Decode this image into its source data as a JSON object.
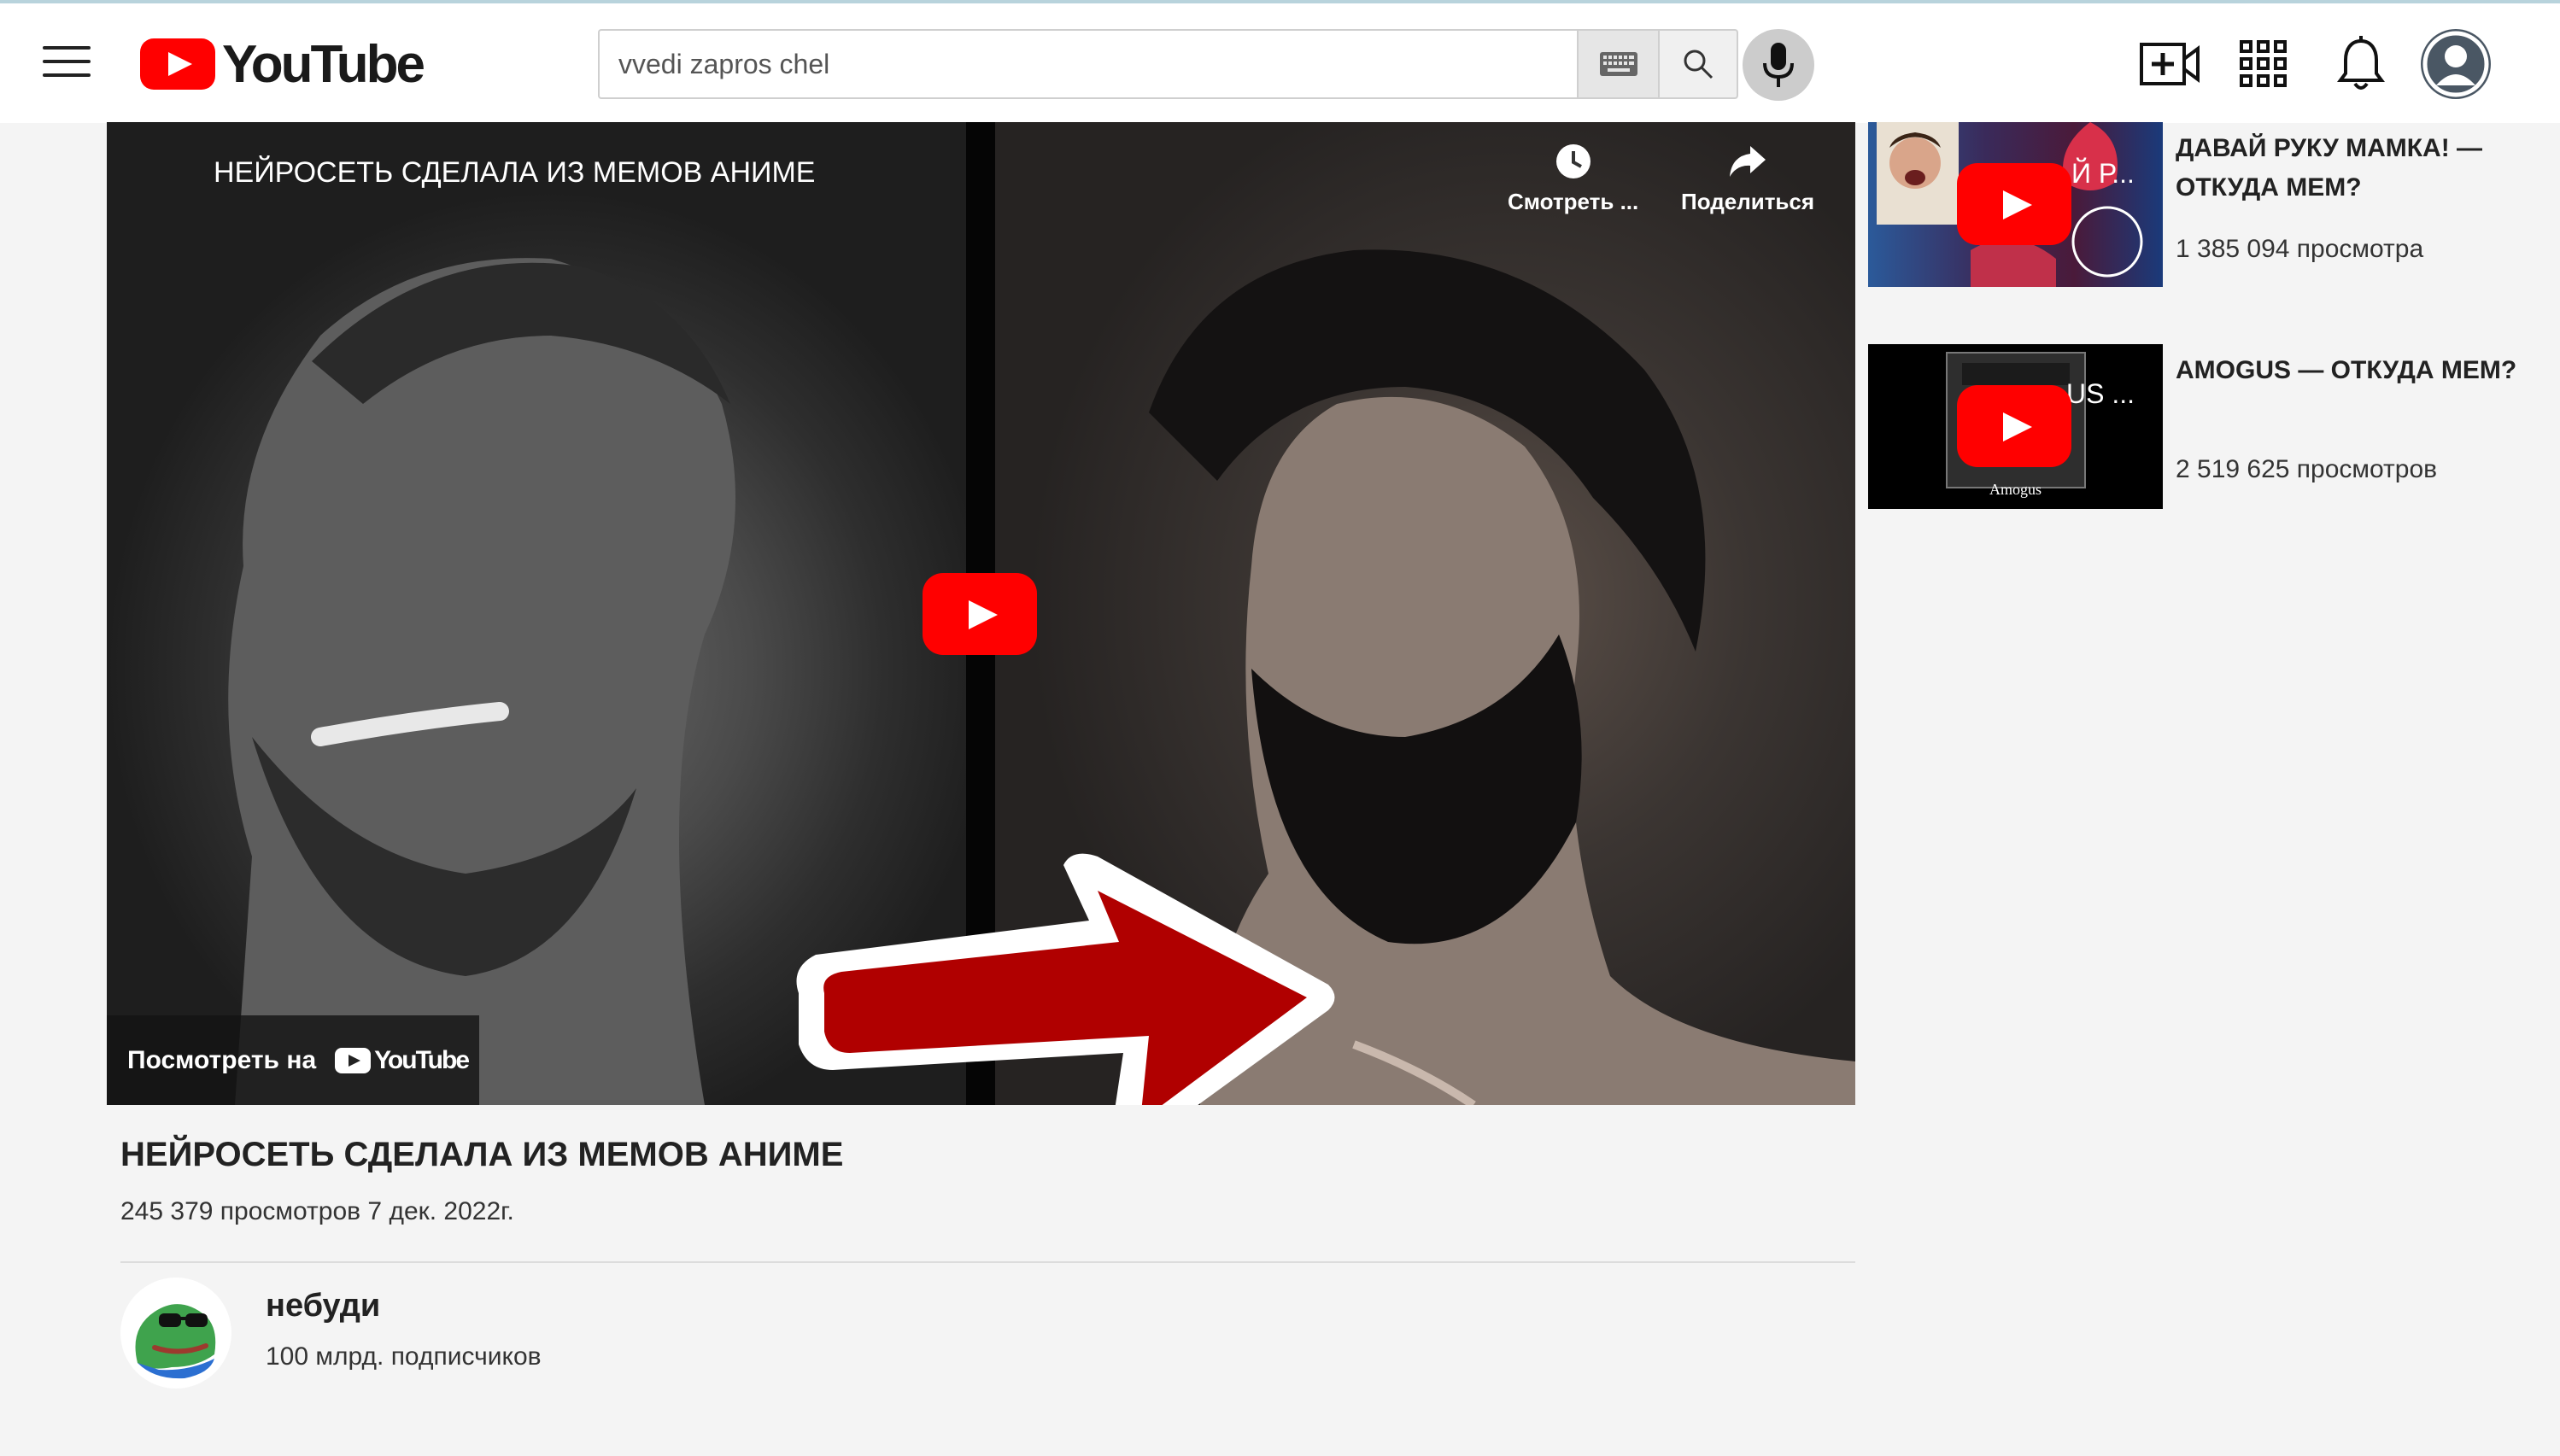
{
  "header": {
    "logo_text": "YouTube",
    "search_placeholder": "vvedi zapros chel"
  },
  "player": {
    "overlay_title": "НЕЙРОСЕТЬ СДЕЛАЛА ИЗ МЕМОВ АНИМЕ",
    "watch_later_label": "Смотреть ...",
    "share_label": "Поделиться",
    "watch_on_label": "Посмотреть на",
    "watch_on_logo": "YouTube"
  },
  "video": {
    "title": "НЕЙРОСЕТЬ СДЕЛАЛА ИЗ МЕМОВ АНИМЕ",
    "meta": "245 379 просмотров 7 дек. 2022г."
  },
  "channel": {
    "name": "небуди",
    "subscribers": "100 млрд. подписчиков"
  },
  "sidebar": {
    "items": [
      {
        "title": "ДАВАЙ РУКУ МАМКА! — ОТКУДА МЕМ?",
        "views": "1 385 094 просмотра",
        "thumb_text": "Й Р..."
      },
      {
        "title": "AMOGUS — ОТКУДА МЕМ?",
        "views": "2 519 625 просмотров",
        "thumb_text": "US ...",
        "thumb_caption": "Amogus"
      }
    ]
  },
  "colors": {
    "accent": "#ff0000",
    "header_bg": "#ffffff",
    "page_bg": "#f4f4f4"
  },
  "icons": [
    "menu-icon",
    "youtube-logo-icon",
    "keyboard-icon",
    "search-icon",
    "mic-icon",
    "create-video-icon",
    "apps-grid-icon",
    "bell-icon",
    "user-avatar-icon",
    "clock-icon",
    "share-icon",
    "play-icon",
    "arrow-graphic"
  ]
}
